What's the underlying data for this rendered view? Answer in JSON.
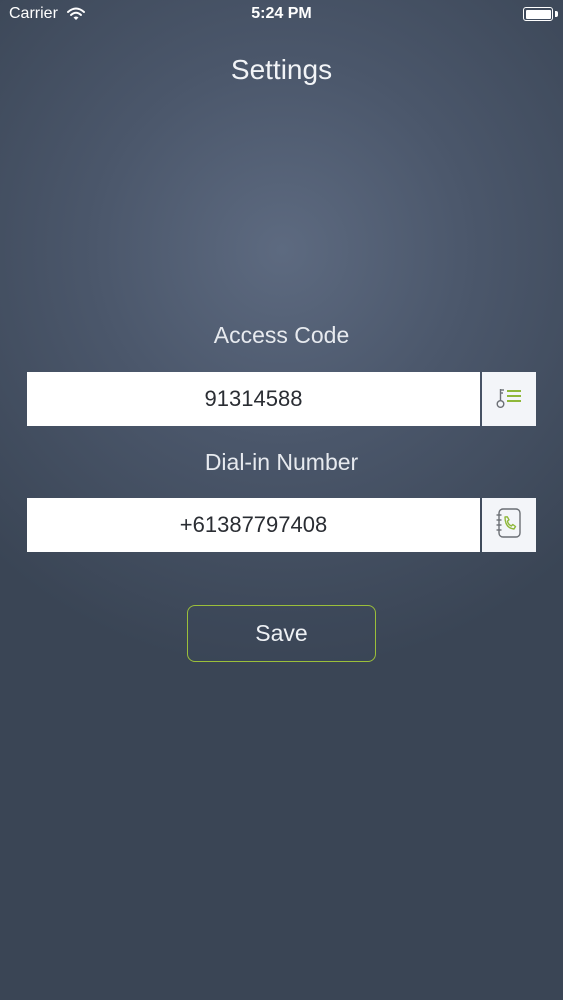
{
  "status_bar": {
    "carrier": "Carrier",
    "time": "5:24 PM",
    "wifi_icon": "wifi-icon",
    "battery_icon": "battery-icon"
  },
  "header": {
    "title": "Settings"
  },
  "form": {
    "access_code": {
      "label": "Access Code",
      "value": "91314588",
      "button_icon": "key-list-icon"
    },
    "dial_in": {
      "label": "Dial-in Number",
      "value": "+61387797408",
      "button_icon": "phone-book-icon"
    },
    "save_label": "Save"
  },
  "colors": {
    "accent": "#9bbf3a",
    "background": "#4b576b",
    "field_background": "#ffffff"
  }
}
